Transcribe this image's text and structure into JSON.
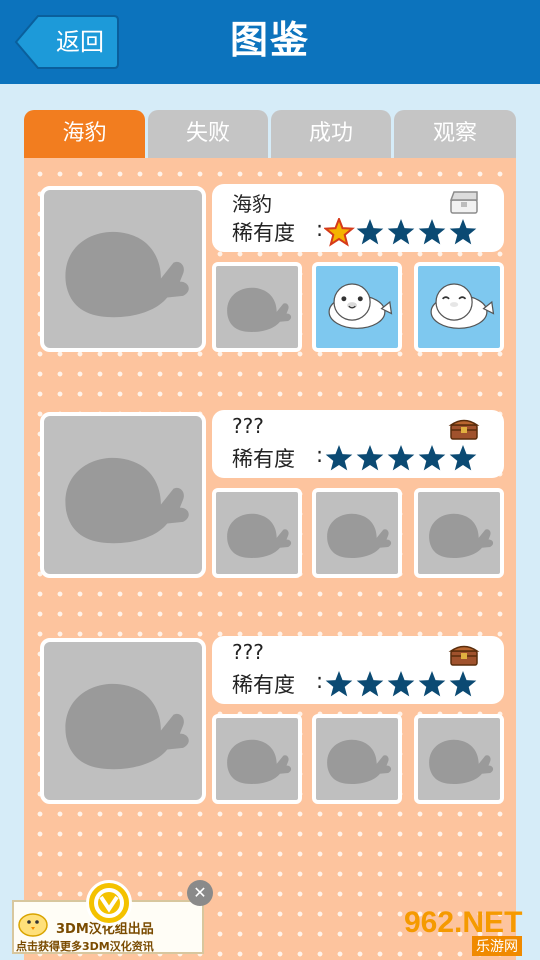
{
  "header": {
    "back_label": "返回",
    "title": "图鉴"
  },
  "tabs": [
    {
      "label": "海豹",
      "active": true
    },
    {
      "label": "失败",
      "active": false
    },
    {
      "label": "成功",
      "active": false
    },
    {
      "label": "观察",
      "active": false
    }
  ],
  "entries": [
    {
      "name": "海豹",
      "rarity_label": "稀有度",
      "rarity_colon": ":",
      "stars_total": 5,
      "special_star": true,
      "chest": "open-white",
      "variants": [
        "locked",
        "seal-1",
        "seal-2"
      ]
    },
    {
      "name": "???",
      "rarity_label": "稀有度",
      "rarity_colon": ":",
      "stars_total": 5,
      "special_star": false,
      "chest": "closed-brown",
      "variants": [
        "locked",
        "locked",
        "locked"
      ]
    },
    {
      "name": "???",
      "rarity_label": "稀有度",
      "rarity_colon": ":",
      "stars_total": 5,
      "special_star": false,
      "chest": "closed-brown",
      "variants": [
        "locked",
        "locked",
        "locked"
      ]
    }
  ],
  "ad": {
    "line1": "3DM汉化组出品",
    "line2": "点击获得更多3DM汉化资讯"
  },
  "watermark": {
    "site": "962.NET",
    "sub": "乐游网"
  },
  "colors": {
    "header": "#0c73bd",
    "tab_active": "#f27d1f",
    "tab_inactive": "#c5c5c5",
    "panel": "#fdc49e",
    "star": "#0b4a73",
    "thumb_blue": "#7ec8ef"
  }
}
